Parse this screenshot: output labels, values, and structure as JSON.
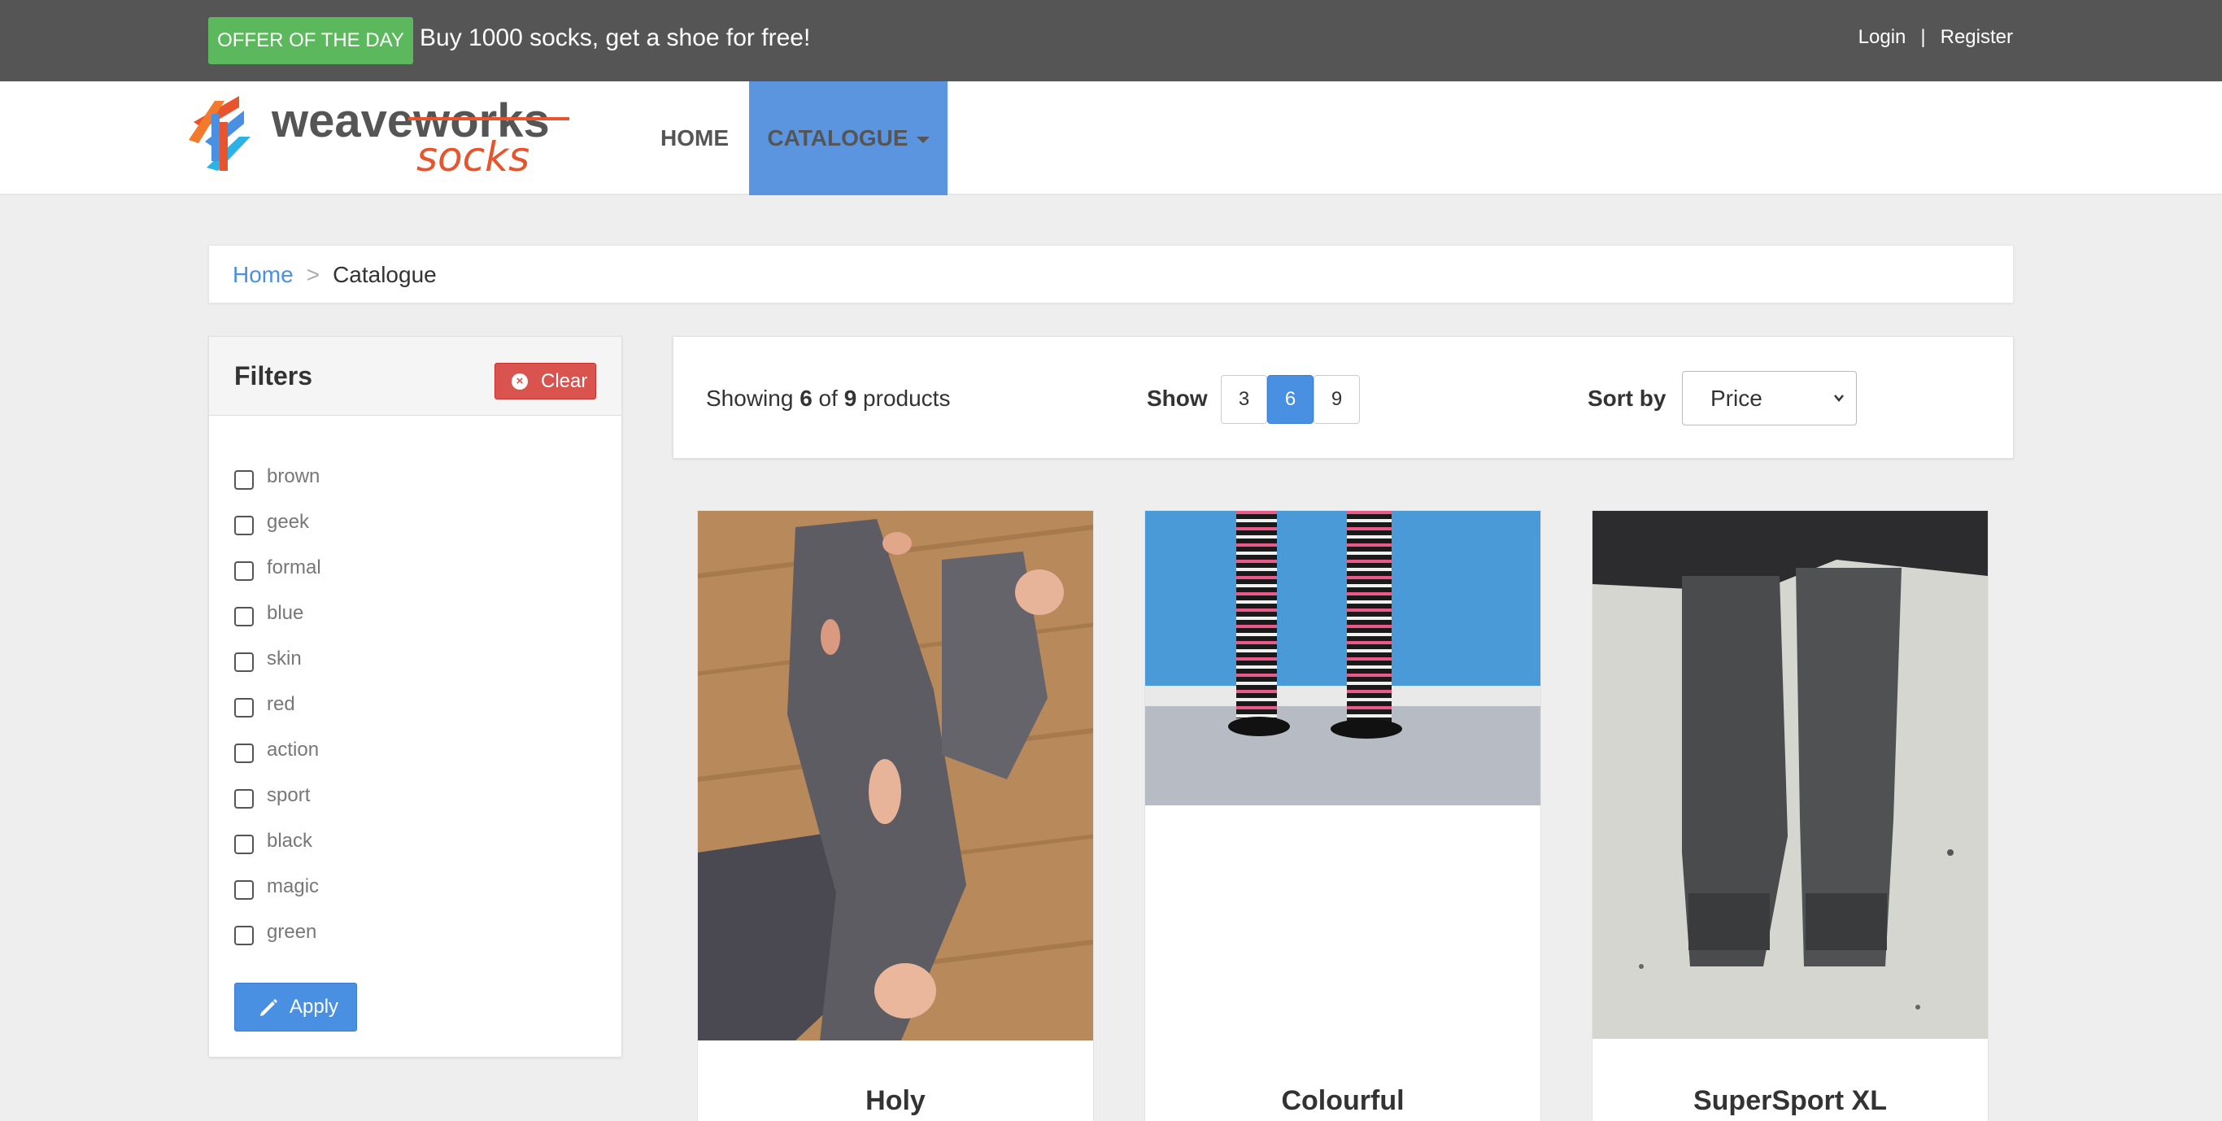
{
  "topbar": {
    "offer_badge": "OFFER OF THE DAY",
    "offer_text": "Buy 1000 socks, get a shoe for free!",
    "login": "Login",
    "separator": "|",
    "register": "Register"
  },
  "logo": {
    "word1": "weaveworks",
    "word2": "socks"
  },
  "nav": {
    "home": "HOME",
    "catalogue": "CATALOGUE"
  },
  "breadcrumb": {
    "home": "Home",
    "separator": ">",
    "current": "Catalogue"
  },
  "filters": {
    "title": "Filters",
    "clear_label": "Clear",
    "apply_label": "Apply",
    "items": [
      {
        "label": "brown"
      },
      {
        "label": "geek"
      },
      {
        "label": "formal"
      },
      {
        "label": "blue"
      },
      {
        "label": "skin"
      },
      {
        "label": "red"
      },
      {
        "label": "action"
      },
      {
        "label": "sport"
      },
      {
        "label": "black"
      },
      {
        "label": "magic"
      },
      {
        "label": "green"
      }
    ]
  },
  "toolbar": {
    "showing_prefix": "Showing",
    "showing_count": "6",
    "showing_of": "of",
    "showing_total": "9",
    "showing_suffix": "products",
    "show_label": "Show",
    "page_sizes": [
      "3",
      "6",
      "9"
    ],
    "active_page_size": "6",
    "sort_label": "Sort by",
    "sort_value": "Price"
  },
  "products": [
    {
      "name": "Holy"
    },
    {
      "name": "Colourful"
    },
    {
      "name": "SuperSport XL"
    }
  ],
  "colors": {
    "topbar": "#555555",
    "offer_green": "#5cb85c",
    "accent_blue": "#4a90e2",
    "clear_red": "#d9534f",
    "page_bg": "#eeeeee"
  }
}
